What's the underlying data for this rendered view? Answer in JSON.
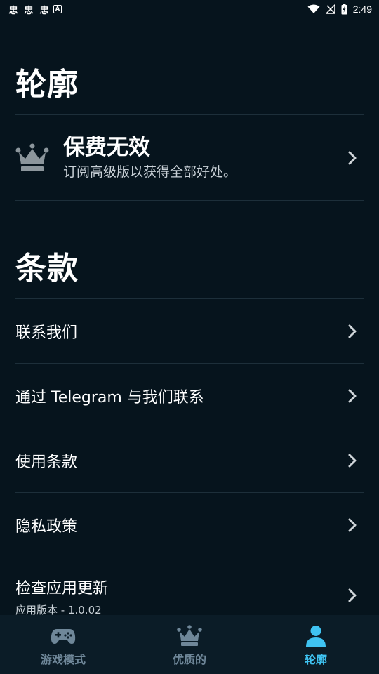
{
  "status_bar": {
    "notif_glyph": "忠",
    "a_glyph": "A",
    "time": "2:49"
  },
  "profile": {
    "title": "轮廓",
    "premium": {
      "title": "保费无效",
      "subtitle": "订阅高级版以获得全部好处。"
    }
  },
  "terms": {
    "title": "条款",
    "items": [
      {
        "label": "联系我们"
      },
      {
        "label": "通过 Telegram 与我们联系"
      },
      {
        "label": "使用条款"
      },
      {
        "label": "隐私政策"
      },
      {
        "label": "检查应用更新",
        "sub": "应用版本 - 1.0.02"
      }
    ]
  },
  "bottom_nav": {
    "items": [
      {
        "label": "游戏模式",
        "icon": "gamepad-icon"
      },
      {
        "label": "优质的",
        "icon": "crown-icon"
      },
      {
        "label": "轮廓",
        "icon": "user-icon",
        "active": true
      }
    ],
    "colors": {
      "active": "#3fc3f2",
      "inactive": "#6f8799"
    }
  }
}
